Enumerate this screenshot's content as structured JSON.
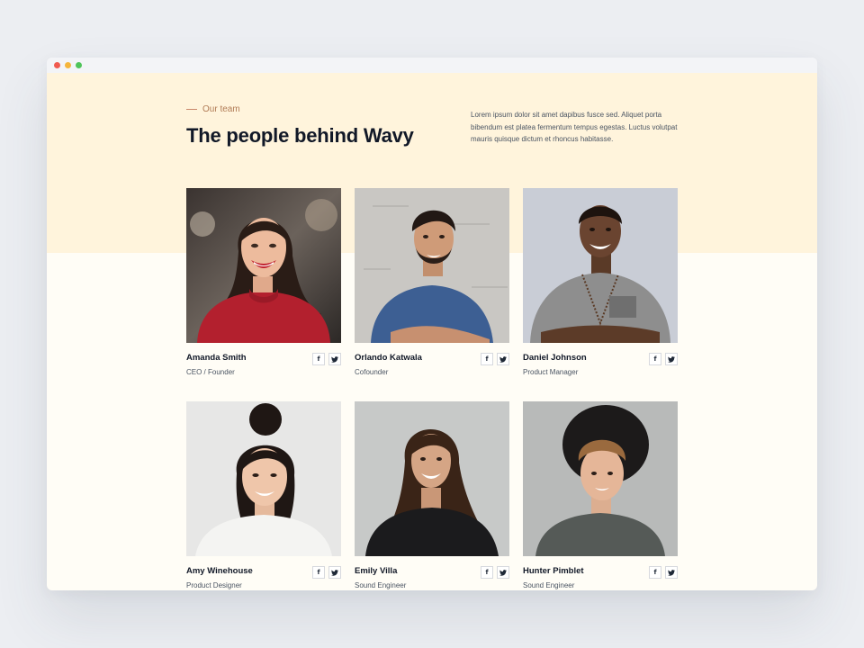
{
  "colors": {
    "page_bg": "#eceef2",
    "hero_band": "#fff4dc",
    "content_bg": "#fffdf6",
    "accent": "#b07a54",
    "heading": "#111827"
  },
  "window": {
    "controls": [
      "close",
      "minimize",
      "maximize"
    ]
  },
  "section": {
    "eyebrow": "Our team",
    "title": "The people behind Wavy",
    "intro": "Lorem ipsum dolor sit amet dapibus fusce sed. Aliquet porta bibendum est platea fermentum tempus egestas. Luctus volutpat mauris quisque dictum et rhoncus habitasse."
  },
  "social_icons": {
    "facebook": "f",
    "twitter": "twitter-icon"
  },
  "team": [
    {
      "name": "Amanda Smith",
      "role": "CEO / Founder"
    },
    {
      "name": "Orlando Katwala",
      "role": "Cofounder"
    },
    {
      "name": "Daniel Johnson",
      "role": "Product Manager"
    },
    {
      "name": "Amy Winehouse",
      "role": "Product Designer"
    },
    {
      "name": "Emily Villa",
      "role": "Sound Engineer"
    },
    {
      "name": "Hunter Pimblet",
      "role": "Sound Engineer"
    }
  ]
}
